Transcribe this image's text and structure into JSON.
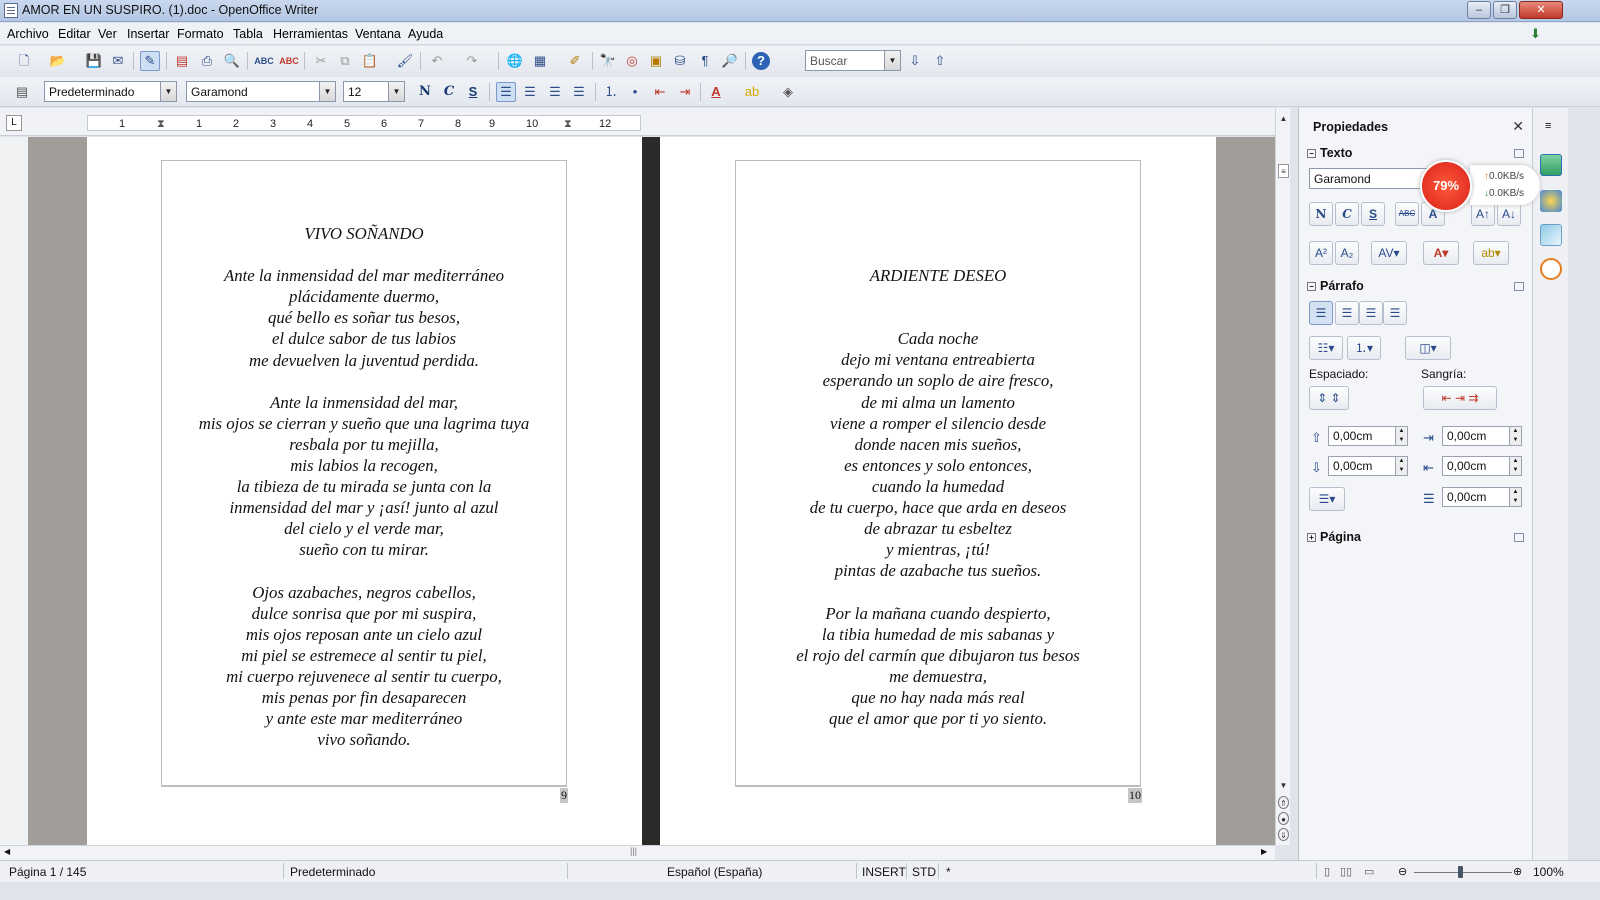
{
  "window": {
    "title": "AMOR EN UN SUSPIRO. (1).doc - OpenOffice Writer",
    "controls": [
      "‒",
      "❐",
      "✕"
    ]
  },
  "menu": [
    "Archivo",
    "Editar",
    "Ver",
    "Insertar",
    "Formato",
    "Tabla",
    "Herramientas",
    "Ventana",
    "Ayuda"
  ],
  "toolbar": {
    "search_placeholder": "Buscar"
  },
  "format_bar": {
    "paragraph_style": "Predeterminado",
    "font_name": "Garamond",
    "font_size": "12",
    "bold": "N",
    "italic": "C",
    "underline": "S"
  },
  "ruler": {
    "ticks": [
      "1",
      "1",
      "2",
      "3",
      "4",
      "5",
      "6",
      "7",
      "8",
      "9",
      "10",
      "11",
      "12"
    ]
  },
  "document": {
    "page_left": {
      "lines": [
        "VIVO SOÑANDO",
        "",
        "Ante la inmensidad del mar mediterráneo",
        "plácidamente duermo,",
        "qué bello es soñar tus besos,",
        "el dulce sabor de tus labios",
        "me devuelven la juventud perdida.",
        "",
        "Ante la inmensidad del mar,",
        "mis ojos se cierran y sueño que una lagrima tuya",
        "resbala por tu mejilla,",
        "mis labios la recogen,",
        "la tibieza de tu mirada se junta con la",
        "inmensidad del mar y ¡así! junto al azul",
        "del cielo y el verde mar,",
        "sueño con tu mirar.",
        "",
        "Ojos azabaches, negros cabellos,",
        "dulce sonrisa que por mi suspira,",
        "mis ojos reposan ante un cielo azul",
        "mi piel se estremece al sentir tu piel,",
        "mi cuerpo rejuvenece al sentir tu cuerpo,",
        "mis penas por fin desaparecen",
        "y ante este mar mediterráneo",
        "vivo soñando."
      ],
      "page_number": "9"
    },
    "page_right": {
      "lines": [
        "ARDIENTE DESEO",
        "",
        "",
        "Cada noche",
        "dejo mi ventana entreabierta",
        "esperando un soplo de aire fresco,",
        "de mi alma un lamento",
        "viene a romper el silencio desde",
        "donde nacen mis sueños,",
        "es entonces y solo entonces,",
        "cuando la humedad",
        "de tu cuerpo, hace que arda en deseos",
        "de abrazar tu esbeltez",
        "y mientras, ¡tú!",
        "pintas de azabache tus sueños.",
        "",
        "Por la mañana cuando despierto,",
        "la tibia humedad de mis sabanas y",
        "el rojo del carmín que dibujaron tus besos",
        "me demuestra,",
        "que no hay nada más real",
        "que el amor que por ti yo siento."
      ],
      "page_number": "10"
    }
  },
  "sidebar": {
    "title": "Propiedades",
    "texto": {
      "header": "Texto",
      "font": "Garamond",
      "bold": "N",
      "italic": "C",
      "underline": "S",
      "strike": "ABC"
    },
    "parrafo": {
      "header": "Párrafo",
      "espaciado_label": "Espaciado:",
      "sangria_label": "Sangría:",
      "spacing_above": "0,00cm",
      "spacing_below": "0,00cm",
      "indent_before": "0,00cm",
      "indent_after": "0,00cm",
      "indent_first": "0,00cm"
    },
    "pagina": {
      "header": "Página"
    }
  },
  "network_widget": {
    "percent": "79%",
    "up": "0.0KB/s",
    "down": "0.0KB/s"
  },
  "statusbar": {
    "page": "Página  1 / 145",
    "page_style": "Predeterminado",
    "language": "Español (España)",
    "insert_mode": "INSERT",
    "selection_mode": "STD",
    "modified": "*",
    "zoom": "100%"
  },
  "colors": {
    "workspace": "#a19d99",
    "page_gap": "#2c2a29",
    "titlebar": "#b3c6e3",
    "badge": "#e8311f"
  }
}
